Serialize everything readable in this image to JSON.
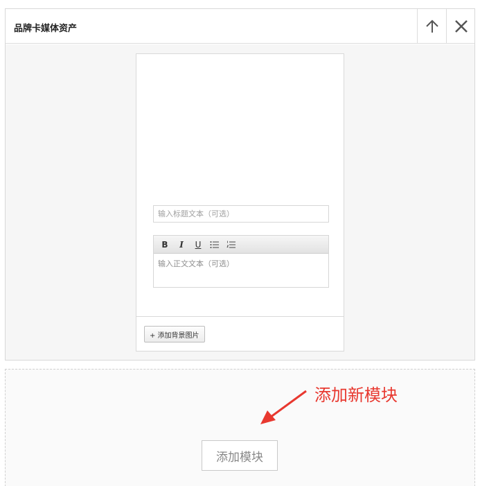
{
  "panel": {
    "title": "品牌卡媒体资产",
    "icons": {
      "up": "arrow-up-icon",
      "close": "close-icon"
    }
  },
  "card": {
    "title_placeholder": "输入标题文本（可选）",
    "body_placeholder": "输入正文文本（可选）",
    "toolbar": {
      "bold": "B",
      "italic": "I",
      "underline": "U"
    },
    "add_bg_label": "+ 添加背景图片"
  },
  "annotation": {
    "text": "添加新模块",
    "color": "#e8382f"
  },
  "add_module_label": "添加模块"
}
